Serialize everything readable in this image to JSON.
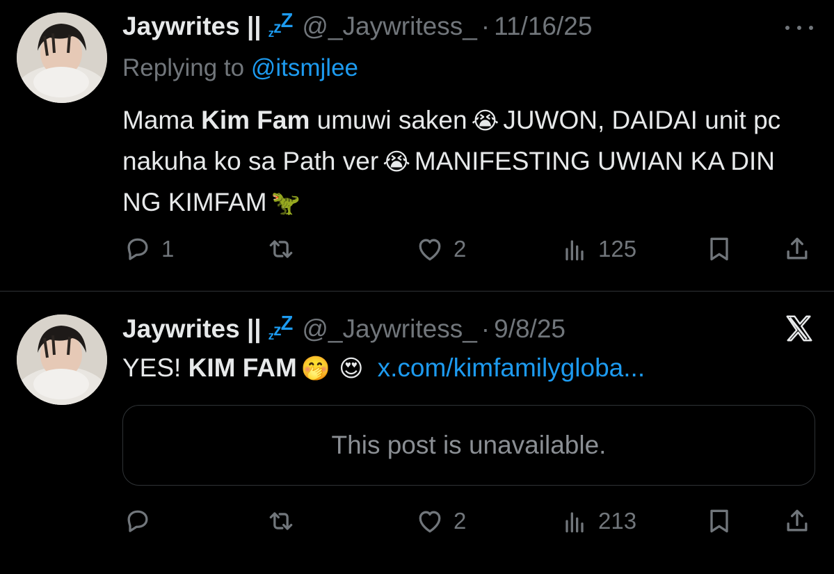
{
  "tweets": [
    {
      "author": {
        "name": "Jaywrites ||",
        "zzz": [
          "z",
          "z",
          "Z"
        ],
        "handle": "@_Jaywritess_",
        "date": "11/16/25"
      },
      "replying_prefix": "Replying to",
      "replying_to": "@itsmjlee",
      "body": {
        "t1": "Mama",
        "b1": "Kim Fam",
        "t2": "umuwi saken",
        "e1": "😭",
        "t3": "JUWON, DAIDAI unit pc nakuha ko sa Path ver",
        "e2": "😭",
        "t4": "MANIFESTING UWIAN KA DIN NG KIMFAM",
        "e3": "🦖"
      },
      "icons": {
        "more": "more-horizontal-icon",
        "reply": "reply-icon",
        "retweet": "retweet-icon",
        "like": "heart-icon",
        "views": "views-icon",
        "bookmark": "bookmark-icon",
        "share": "share-icon"
      },
      "stats": {
        "replies": "1",
        "likes": "2",
        "views": "125"
      }
    },
    {
      "author": {
        "name": "Jaywrites ||",
        "zzz": [
          "z",
          "z",
          "Z"
        ],
        "handle": "@_Jaywritess_",
        "date": "9/8/25"
      },
      "body": {
        "t1": "YES!",
        "b1": "KIM FAM",
        "e1": "🤭",
        "e2": "😍",
        "link": "x.com/kimfamilygloba..."
      },
      "quote_unavailable": "This post is unavailable.",
      "icons": {
        "logo": "x-logo-icon",
        "reply": "reply-icon",
        "retweet": "retweet-icon",
        "like": "heart-icon",
        "views": "views-icon",
        "bookmark": "bookmark-icon",
        "share": "share-icon"
      },
      "stats": {
        "likes": "2",
        "views": "213"
      }
    }
  ],
  "colors": {
    "background": "#000000",
    "text": "#e7e9ea",
    "muted": "#71767b",
    "accent": "#1d9bf0",
    "divider": "#2f3336"
  }
}
